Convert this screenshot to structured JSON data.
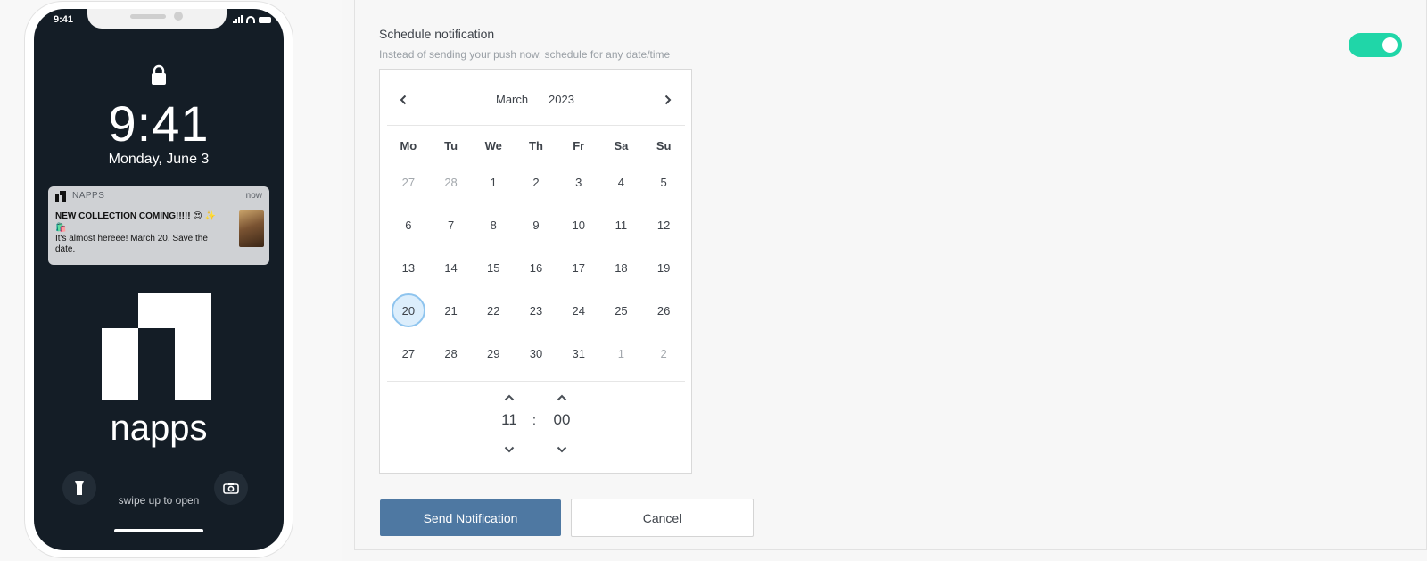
{
  "phone": {
    "status_time": "9:41",
    "lock_time": "9:41",
    "lock_date": "Monday, June 3",
    "notification": {
      "app_name": "NAPPS",
      "time": "now",
      "title": "NEW COLLECTION COMING!!!!! 😍 ✨🛍️",
      "body": "It's almost hereee! March 20. Save the date."
    },
    "logo_text": "napps",
    "swipe_text": "swipe up to open"
  },
  "schedule": {
    "title": "Schedule notification",
    "subtitle": "Instead of sending your push now, schedule for any date/time",
    "enabled": true,
    "toggle_color": "#20d6a8"
  },
  "calendar": {
    "month": "March",
    "year": "2023",
    "weekdays": [
      "Mo",
      "Tu",
      "We",
      "Th",
      "Fr",
      "Sa",
      "Su"
    ],
    "days": [
      {
        "label": "27",
        "muted": true
      },
      {
        "label": "28",
        "muted": true
      },
      {
        "label": "1"
      },
      {
        "label": "2"
      },
      {
        "label": "3"
      },
      {
        "label": "4"
      },
      {
        "label": "5"
      },
      {
        "label": "6"
      },
      {
        "label": "7"
      },
      {
        "label": "8"
      },
      {
        "label": "9"
      },
      {
        "label": "10"
      },
      {
        "label": "11"
      },
      {
        "label": "12"
      },
      {
        "label": "13"
      },
      {
        "label": "14"
      },
      {
        "label": "15"
      },
      {
        "label": "16"
      },
      {
        "label": "17"
      },
      {
        "label": "18"
      },
      {
        "label": "19"
      },
      {
        "label": "20",
        "selected": true
      },
      {
        "label": "21"
      },
      {
        "label": "22"
      },
      {
        "label": "23"
      },
      {
        "label": "24"
      },
      {
        "label": "25"
      },
      {
        "label": "26"
      },
      {
        "label": "27"
      },
      {
        "label": "28"
      },
      {
        "label": "29"
      },
      {
        "label": "30"
      },
      {
        "label": "31"
      },
      {
        "label": "1",
        "muted": true
      },
      {
        "label": "2",
        "muted": true
      }
    ],
    "hours": "11",
    "colon": ":",
    "minutes": "00"
  },
  "actions": {
    "send_label": "Send Notification",
    "cancel_label": "Cancel",
    "send_color": "#4e78a2"
  }
}
